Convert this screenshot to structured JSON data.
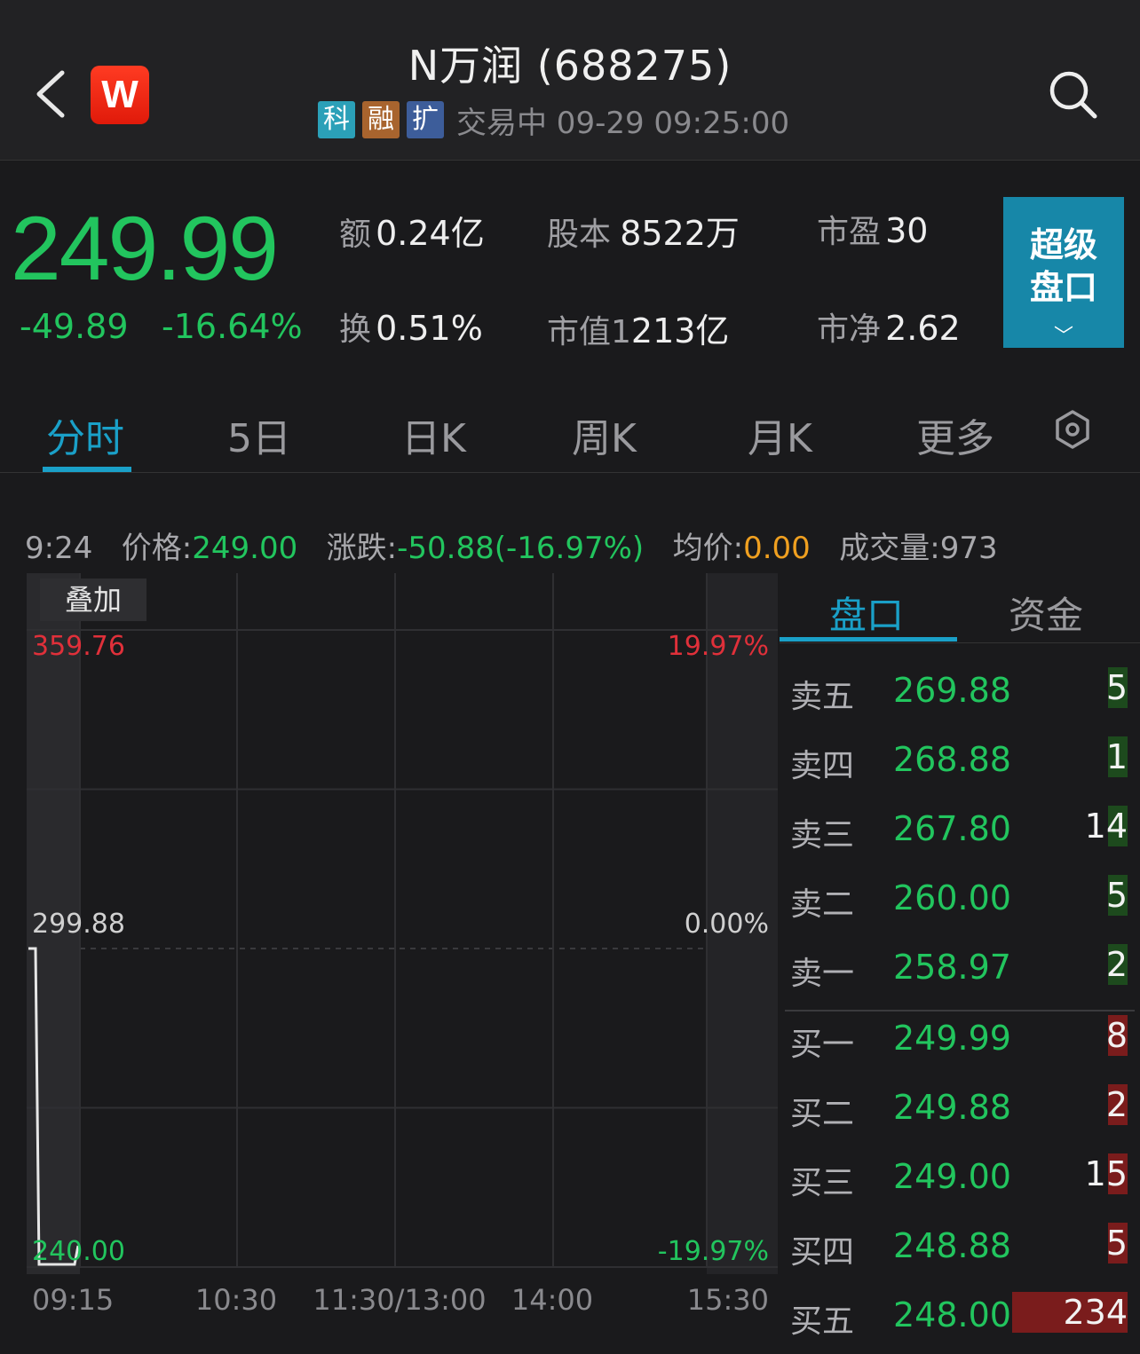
{
  "header": {
    "title": "N万润 (688275)",
    "logo_letter": "W",
    "tags": [
      {
        "label": "科",
        "color": "#2ba0b8"
      },
      {
        "label": "融",
        "color": "#a8642e"
      },
      {
        "label": "扩",
        "color": "#3d5d9a"
      }
    ],
    "status": "交易中 09-29 09:25:00"
  },
  "quote": {
    "price": "249.99",
    "change": "-49.89",
    "change_pct": "-16.64%",
    "stats": [
      {
        "label": "额",
        "value": "0.24亿"
      },
      {
        "label": "股本",
        "value": "8522万"
      },
      {
        "label": "市盈",
        "value": "30"
      },
      {
        "label": "换",
        "value": "0.51%"
      },
      {
        "label": "市值1",
        "value": "213亿"
      },
      {
        "label": "市净",
        "value": "2.62"
      }
    ],
    "super_button": {
      "line1": "超级",
      "line2": "盘口",
      "chevron": "﹀"
    }
  },
  "tabs": [
    "分时",
    "5日",
    "日K",
    "周K",
    "月K",
    "更多"
  ],
  "active_tab": 0,
  "info_line": {
    "time": "9:24",
    "price_label": "价格:",
    "price": "249.00",
    "change_label": "涨跌:",
    "change": "-50.88(-16.97%)",
    "avg_label": "均价:",
    "avg": "0.00",
    "volume_label": "成交量:",
    "volume": "973"
  },
  "chart_data": {
    "type": "line",
    "overlay_button": "叠加",
    "ylim": [
      240.0,
      359.76
    ],
    "reference_price": 299.88,
    "y_tick_labels_left": [
      "359.76",
      "299.88",
      "240.00"
    ],
    "y_tick_labels_right": [
      "19.97%",
      "0.00%",
      "-19.97%"
    ],
    "x_tick_labels": [
      "09:15",
      "10:30",
      "11:30/13:00",
      "14:00",
      "15:30"
    ],
    "series": [
      {
        "values": [
          299.88,
          299.88,
          240.5,
          240.5,
          244.0
        ]
      }
    ],
    "colors": {
      "up": "#e0303a",
      "down": "#22c55e",
      "neutral": "#d0d0d0"
    }
  },
  "order_book": {
    "tabs": [
      "盘口",
      "资金"
    ],
    "asks": [
      {
        "label": "卖五",
        "price": "269.88",
        "volume": "5",
        "share": 0.02
      },
      {
        "label": "卖四",
        "price": "268.88",
        "volume": "1",
        "share": 0.01
      },
      {
        "label": "卖三",
        "price": "267.80",
        "volume": "14",
        "share": 0.06
      },
      {
        "label": "卖二",
        "price": "260.00",
        "volume": "5",
        "share": 0.02
      },
      {
        "label": "卖一",
        "price": "258.97",
        "volume": "2",
        "share": 0.01
      }
    ],
    "bids": [
      {
        "label": "买一",
        "price": "249.99",
        "volume": "8",
        "share": 0.035
      },
      {
        "label": "买二",
        "price": "249.88",
        "volume": "2",
        "share": 0.01
      },
      {
        "label": "买三",
        "price": "249.00",
        "volume": "15",
        "share": 0.065
      },
      {
        "label": "买四",
        "price": "248.88",
        "volume": "5",
        "share": 0.02
      },
      {
        "label": "买五",
        "price": "248.00",
        "volume": "234",
        "share": 1.0
      }
    ],
    "colors": {
      "ask_bar": "#1d4a1d",
      "bid_bar": "#7a1c1c"
    }
  }
}
